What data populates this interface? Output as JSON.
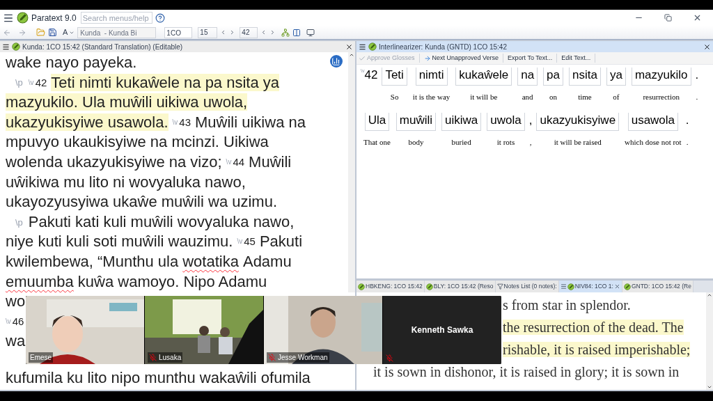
{
  "app": {
    "title": "Paratext 9.0",
    "search": {
      "placeholder": "Search menus/help"
    }
  },
  "toolbar": {
    "font_button": "A",
    "project": "Kunda  - Kunda Bi",
    "book": "1CO",
    "chapter": "15",
    "verse": "42"
  },
  "editor": {
    "title": "Kunda: 1CO 15:42 (Standard Translation) (Editable)",
    "active": false,
    "lines": [
      [
        {
          "kind": "text",
          "text": "wake nayo payeka.",
          "highlighted": false,
          "misspelled": false
        }
      ],
      [
        {
          "kind": "para",
          "text": "\\p"
        },
        {
          "kind": "verse",
          "marker": "\\v",
          "number": "42"
        },
        {
          "kind": "text",
          "text": "Teti nimti kukaŵele na pa nsita ya",
          "highlighted": true,
          "misspelled": false
        }
      ],
      [
        {
          "kind": "text",
          "text": "mazyukilo. Ula muŵili uikiwa uwola,",
          "highlighted": true,
          "misspelled": false
        }
      ],
      [
        {
          "kind": "text",
          "text": "ukazyukisyiwe usawola.",
          "highlighted": true,
          "misspelled": false
        },
        {
          "kind": "verse",
          "marker": "\\v",
          "number": "43"
        },
        {
          "kind": "text",
          "text": "Muŵili uikiwa na",
          "highlighted": false,
          "misspelled": false
        }
      ],
      [
        {
          "kind": "text",
          "text": "mpuvyo ukaukisyiwe na mcinzi. Uikiwa",
          "highlighted": false,
          "misspelled": false
        }
      ],
      [
        {
          "kind": "text",
          "text": "wolenda ukazyukisyiwe na vizo;",
          "highlighted": false,
          "misspelled": false
        },
        {
          "kind": "verse",
          "marker": "\\v",
          "number": "44"
        },
        {
          "kind": "text",
          "text": "Muŵili",
          "highlighted": false,
          "misspelled": false
        }
      ],
      [
        {
          "kind": "text",
          "text": "uŵikiwa mu lito ni wovyaluka nawo,",
          "highlighted": false,
          "misspelled": false
        }
      ],
      [
        {
          "kind": "text",
          "text": "ukayozyusyiwa ukaŵe muŵili wa uzimu.",
          "highlighted": false,
          "misspelled": false
        }
      ],
      [
        {
          "kind": "para",
          "text": "\\p"
        },
        {
          "kind": "text",
          "text": "Pakuti kati kuli muŵili wovyaluka nawo,",
          "highlighted": false,
          "misspelled": false
        }
      ],
      [
        {
          "kind": "text",
          "text": "niye kuti kuli soti muŵili wauzimu.",
          "highlighted": false,
          "misspelled": false
        },
        {
          "kind": "verse",
          "marker": "\\v",
          "number": "45"
        },
        {
          "kind": "text",
          "text": "Pakuti",
          "highlighted": false,
          "misspelled": false
        }
      ],
      [
        {
          "kind": "text",
          "text": "kwilembewa, “Munthu ula",
          "highlighted": false,
          "misspelled": false
        },
        {
          "kind": "text",
          "text": "wotatika",
          "highlighted": false,
          "misspelled": true
        },
        {
          "kind": "text",
          "text": "Adamu",
          "highlighted": false,
          "misspelled": false
        }
      ],
      [
        {
          "kind": "text",
          "text": "emuumba",
          "highlighted": false,
          "misspelled": true
        },
        {
          "kind": "text",
          "text": "kuŵa wamoyo. Nipo Adamu",
          "highlighted": false,
          "misspelled": false
        }
      ],
      [
        {
          "kind": "text",
          "text": "wo",
          "highlighted": false,
          "misspelled": false
        }
      ],
      [
        {
          "kind": "verse",
          "marker": "\\v",
          "number": "46"
        }
      ],
      [
        {
          "kind": "text",
          "text": "wa",
          "highlighted": false,
          "misspelled": false
        }
      ],
      [
        {
          "kind": "text",
          "text": "kufumila ku lito nipo munthu wakaŵili ofumila",
          "highlighted": false,
          "misspelled": false
        }
      ]
    ]
  },
  "interlinearizer": {
    "title": "Interlinearizer: Kunda (GNTD) 1CO 15:42",
    "active": true,
    "actions": [
      {
        "label": "Approve Glosses",
        "disabled": true
      },
      {
        "label": "Next Unapproved Verse",
        "disabled": false
      },
      {
        "label": "Export To Text...",
        "disabled": false
      },
      {
        "label": "Edit Text...",
        "disabled": false
      }
    ],
    "verse_marker": "\\v",
    "verse_number": "42",
    "items": [
      {
        "kind": "word",
        "word": "Teti",
        "gloss": "So"
      },
      {
        "kind": "word",
        "word": "nimti",
        "gloss": "it is the way"
      },
      {
        "kind": "word",
        "word": "kukaŵele",
        "gloss": "it will be"
      },
      {
        "kind": "word",
        "word": "na",
        "gloss": "and"
      },
      {
        "kind": "word",
        "word": "pa",
        "gloss": "on"
      },
      {
        "kind": "word",
        "word": "nsita",
        "gloss": "time"
      },
      {
        "kind": "word",
        "word": "ya",
        "gloss": "of"
      },
      {
        "kind": "word",
        "word": "mazyukilo",
        "gloss": "resurrection"
      },
      {
        "kind": "punct",
        "word": ".",
        "gloss": "."
      },
      {
        "kind": "word",
        "word": "Ula",
        "gloss": "That one"
      },
      {
        "kind": "word",
        "word": "muŵili",
        "gloss": "body"
      },
      {
        "kind": "word",
        "word": "uikiwa",
        "gloss": "buried"
      },
      {
        "kind": "word",
        "word": "uwola",
        "gloss": "it rots"
      },
      {
        "kind": "punct",
        "word": ",",
        "gloss": ","
      },
      {
        "kind": "word",
        "word": "ukazyukisyiwe",
        "gloss": "it will be raised"
      },
      {
        "kind": "word",
        "word": "usawola",
        "gloss": "which dose not rot"
      },
      {
        "kind": "punct",
        "word": ".",
        "gloss": "."
      }
    ]
  },
  "resource_tabs": [
    {
      "label": "HBKENG: 1CO 15:42",
      "kind": "text",
      "selected": false
    },
    {
      "label": "BLY: 1CO 15:42 (Reso",
      "kind": "text",
      "selected": false
    },
    {
      "label": "Notes List (0 notes):",
      "kind": "notes",
      "selected": false
    },
    {
      "label": "NIV84: 1CO 1:",
      "kind": "text",
      "selected": true
    },
    {
      "label": "GNTD: 1CO 15:42 (Re",
      "kind": "text",
      "selected": false
    }
  ],
  "resource_text": [
    {
      "text": "s from star in splendor.",
      "covered": true,
      "highlighted": false
    },
    {
      "text": "the resurrection of the dead. The",
      "covered": true,
      "highlighted": true
    },
    {
      "text": "rishable, it is raised imperishable;",
      "covered": true,
      "highlighted": true
    },
    {
      "text": "it is sown in dishonor, it is raised in glory; it is sown in",
      "covered": false,
      "highlighted": false
    }
  ],
  "video_call": [
    {
      "name": "Emese",
      "kind": "video",
      "muted": false
    },
    {
      "name": "Lusaka",
      "kind": "video",
      "muted": true
    },
    {
      "name": "Jesse Workman",
      "kind": "video",
      "muted": true
    },
    {
      "name": "Kenneth Sawka",
      "kind": "name_only",
      "muted": true
    }
  ]
}
